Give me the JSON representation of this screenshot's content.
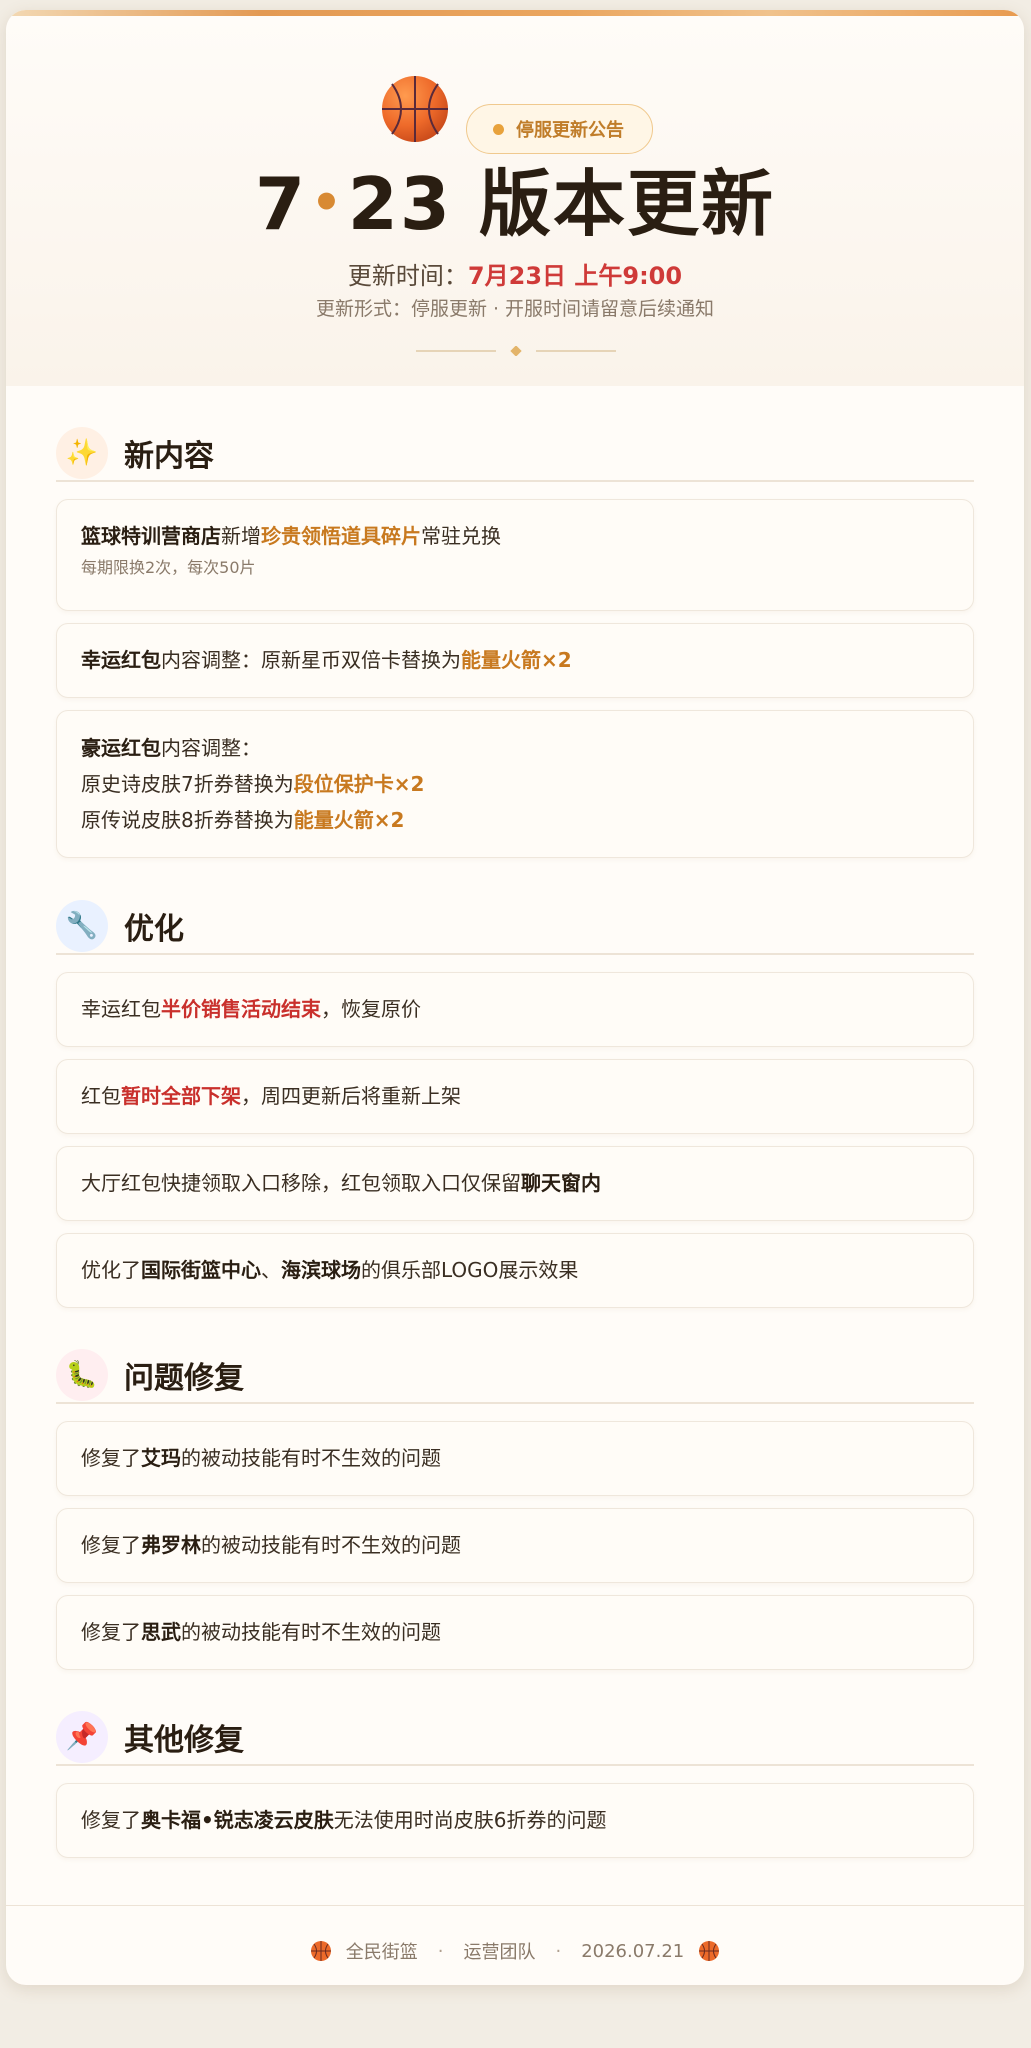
{
  "header": {
    "badge": "停服更新公告",
    "title_main": "7",
    "title_dot": "•",
    "title_rest": "23 版本更新",
    "time_label": "更新时间：",
    "time_value": "7月23日 上午9:00",
    "subtitle": "更新形式：停服更新 · 开服时间请留意后续通知"
  },
  "sections": {
    "new": {
      "icon": "sparkles-icon",
      "icon_glyph": "✨",
      "title": "新内容",
      "items": [
        {
          "a": "篮球特训营商店",
          "b": "新增",
          "c": "珍贵领悟道具碎片",
          "d": "常驻兑换",
          "note": "每期限换2次，每次50片"
        },
        {
          "a": "幸运红包",
          "b": "内容调整：原新星币双倍卡替换为",
          "c": "能量火箭×2"
        },
        {
          "a": "豪运红包",
          "b": "内容调整：",
          "l2a": "原史诗皮肤7折券替换为",
          "l2b": "段位保护卡×2",
          "l3a": "原传说皮肤8折券替换为",
          "l3b": "能量火箭×2"
        }
      ]
    },
    "opt": {
      "icon": "wrench-icon",
      "icon_glyph": "🔧",
      "title": "优化",
      "items": [
        {
          "a": "幸运红包",
          "b": "半价销售活动结束",
          "c": "，恢复原价"
        },
        {
          "a": "红包",
          "b": "暂时全部下架",
          "c": "，周四更新后将重新上架"
        },
        {
          "a": "大厅红包快捷领取入口移除，红包领取入口仅保留",
          "b": "聊天窗内"
        },
        {
          "a": "优化了",
          "b": "国际街篮中心",
          "c": "、",
          "d": "海滨球场",
          "e": "的俱乐部LOGO展示效果"
        }
      ]
    },
    "bug": {
      "icon": "bug-icon",
      "icon_glyph": "🐛",
      "title": "问题修复",
      "items": [
        {
          "a": "修复了",
          "b": "艾玛",
          "c": "的被动技能有时不生效的问题"
        },
        {
          "a": "修复了",
          "b": "弗罗林",
          "c": "的被动技能有时不生效的问题"
        },
        {
          "a": "修复了",
          "b": "思武",
          "c": "的被动技能有时不生效的问题"
        }
      ]
    },
    "other": {
      "icon": "pushpin-icon",
      "icon_glyph": "📌",
      "title": "其他修复",
      "items": [
        {
          "a": "修复了",
          "b": "奥卡福•锐志凌云皮肤",
          "c": "无法使用时尚皮肤6折券的问题"
        }
      ]
    }
  },
  "footer": {
    "game": "全民街篮",
    "team": "运营团队",
    "date": "2026.07.21",
    "sep": "·"
  },
  "colors": {
    "accent": "#d88a33",
    "highlight_gold": "#c8791f",
    "highlight_red": "#c9302c"
  }
}
